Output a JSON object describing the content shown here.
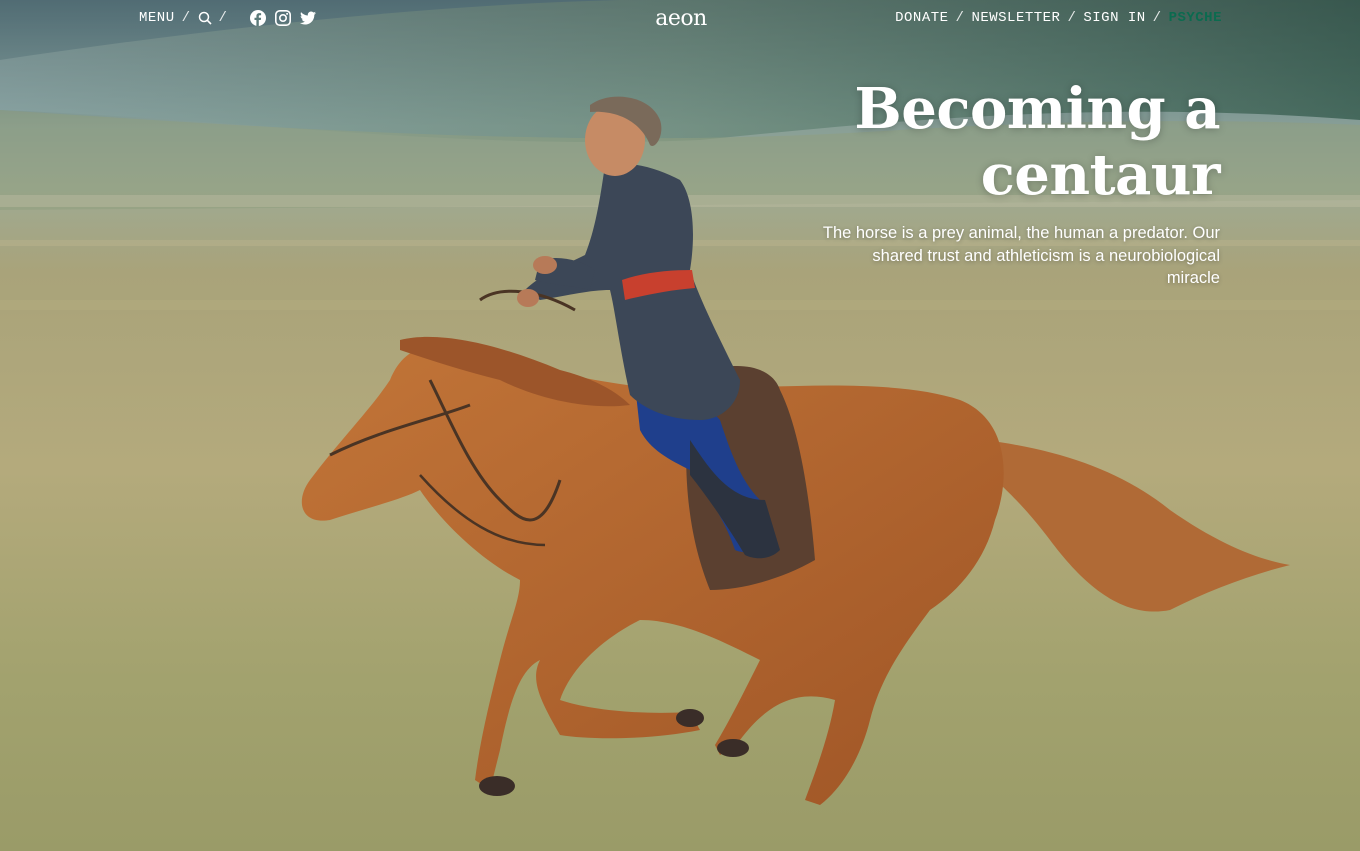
{
  "header": {
    "menu_label": "MENU",
    "separator": "/",
    "logo_text": "aeon",
    "right_nav": [
      {
        "label": "DONATE"
      },
      {
        "label": "NEWSLETTER"
      },
      {
        "label": "SIGN IN"
      },
      {
        "label": "PSYCHE"
      }
    ],
    "icons": {
      "search": "search-icon",
      "facebook": "facebook-icon",
      "instagram": "instagram-icon",
      "twitter": "twitter-icon"
    }
  },
  "article": {
    "title": "Becoming a centaur",
    "standfirst": "The horse is a prey animal, the human a predator. Our shared trust and athleticism is a neurobiological miracle"
  },
  "colors": {
    "text": "#ffffff",
    "psyche_accent": "#0b6b4f",
    "sky_top": "#6f8e95",
    "grass": "#a9a071",
    "horse": "#b9692f"
  }
}
